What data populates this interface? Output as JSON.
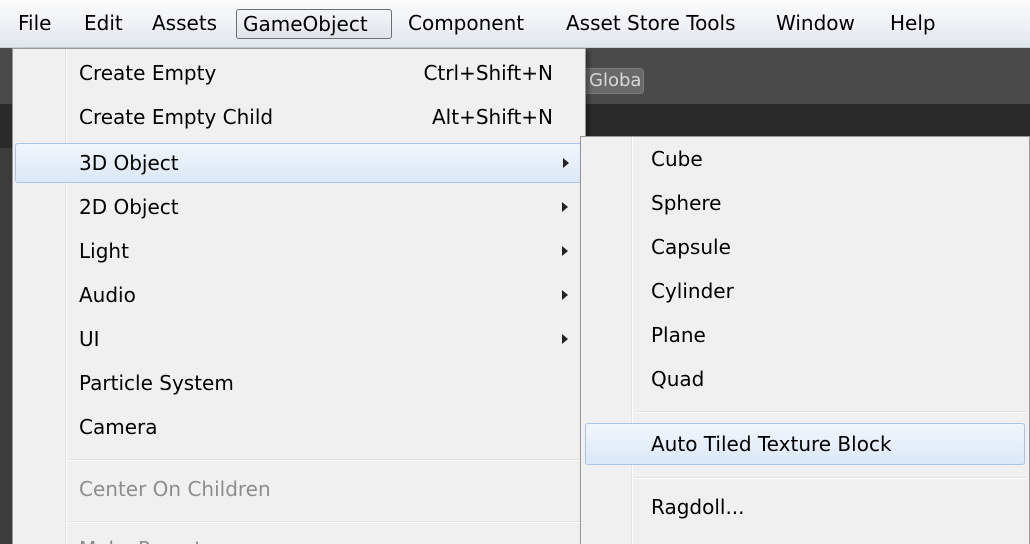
{
  "menubar": {
    "items": [
      "File",
      "Edit",
      "Assets",
      "GameObject",
      "Component",
      "Asset Store Tools",
      "Window",
      "Help"
    ],
    "open_item": "GameObject"
  },
  "background": {
    "chip_text": "Global"
  },
  "gameobject_menu": {
    "items": [
      {
        "label": "Create Empty",
        "shortcut": "Ctrl+Shift+N"
      },
      {
        "label": "Create Empty Child",
        "shortcut": "Alt+Shift+N"
      },
      {
        "label": "3D Object",
        "submenu": true,
        "highlighted": true
      },
      {
        "label": "2D Object",
        "submenu": true
      },
      {
        "label": "Light",
        "submenu": true
      },
      {
        "label": "Audio",
        "submenu": true
      },
      {
        "label": "UI",
        "submenu": true
      },
      {
        "label": "Particle System"
      },
      {
        "label": "Camera"
      },
      {
        "label": "Center On Children",
        "disabled": true
      },
      {
        "label": "Make Parent",
        "disabled": true
      }
    ]
  },
  "object_3d_submenu": {
    "items": [
      {
        "label": "Cube"
      },
      {
        "label": "Sphere"
      },
      {
        "label": "Capsule"
      },
      {
        "label": "Cylinder"
      },
      {
        "label": "Plane"
      },
      {
        "label": "Quad"
      },
      {
        "label": "Auto Tiled Texture Block",
        "highlighted": true
      },
      {
        "label": "Ragdoll..."
      }
    ]
  },
  "icons": {
    "submenu_arrow": "chevron-right-icon"
  },
  "colors": {
    "menu_bg": "#f0f0f0",
    "highlight_border": "#a8c4e6",
    "highlight_bg": "#dbe8f7",
    "disabled_text": "#8d8d8d",
    "editor_bg": "#3c3c3c"
  }
}
